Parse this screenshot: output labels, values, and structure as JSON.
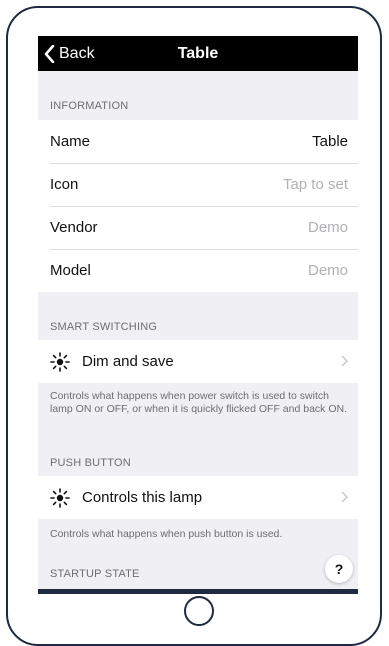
{
  "nav": {
    "back_label": "Back",
    "title": "Table"
  },
  "information": {
    "header": "INFORMATION",
    "rows": [
      {
        "label": "Name",
        "value": "Table",
        "muted": false
      },
      {
        "label": "Icon",
        "value": "Tap to set",
        "muted": true
      },
      {
        "label": "Vendor",
        "value": "Demo",
        "muted": true
      },
      {
        "label": "Model",
        "value": "Demo",
        "muted": true
      }
    ]
  },
  "smart_switching": {
    "header": "SMART SWITCHING",
    "row_label": "Dim and save",
    "note": "Controls what happens when power switch is used to switch lamp ON or OFF, or when it is quickly flicked OFF and back ON."
  },
  "push_button": {
    "header": "PUSH BUTTON",
    "row_label": "Controls this lamp",
    "note": "Controls what happens when push button is used."
  },
  "startup_state": {
    "header": "STARTUP STATE"
  },
  "help": {
    "label": "?"
  },
  "colors": {
    "navbar": "#000000",
    "background": "#efeff4",
    "frame": "#1e2a40",
    "muted_text": "#b0b0b5"
  },
  "icons": {
    "back": "chevron-left-icon",
    "row_icon": "sun-icon",
    "disclosure": "chevron-right-icon"
  }
}
